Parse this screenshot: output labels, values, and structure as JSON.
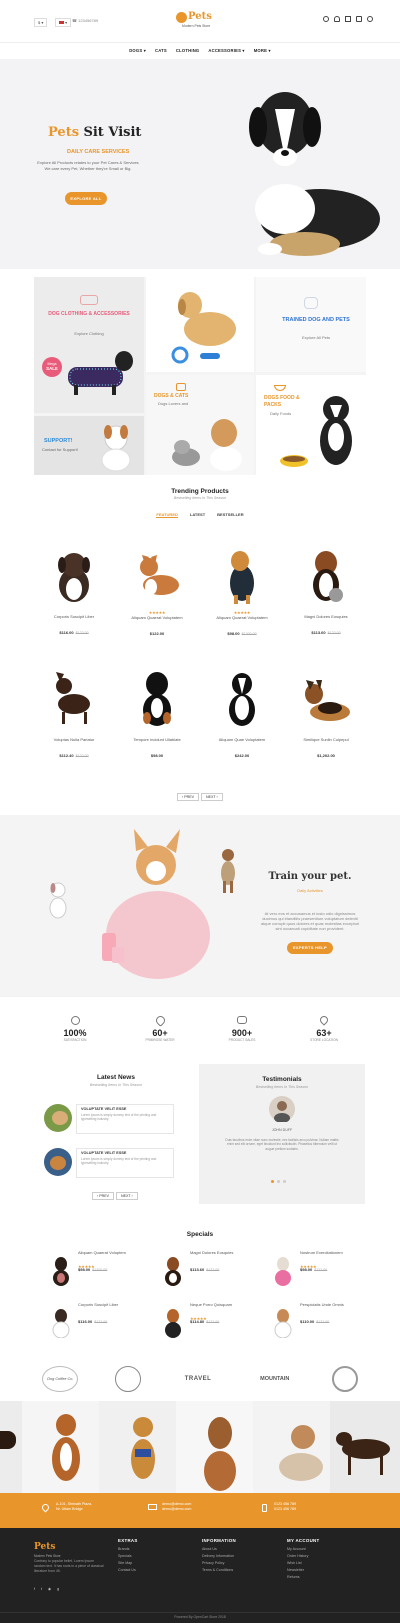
{
  "header": {
    "currency": "$",
    "phone": "123456789",
    "logo_text": "Pets",
    "logo_sub": "Modern Pets Store",
    "nav": [
      "DOGS",
      "CATS",
      "CLOTHING",
      "ACCESSORIES",
      "MORE"
    ]
  },
  "hero": {
    "title_a": "Pets",
    "title_b": "Sit Visit",
    "subtitle": "DAILY CARE SERVICES",
    "desc_1": "Explore All Products relates to your Pet Cares & Services",
    "desc_2": "We care every Pet, Whether they're Small or Big.",
    "cta": "EXPLORE ALL"
  },
  "banners": {
    "clothing_title": "DOG CLOTHING & ACCESSORIES",
    "clothing_sub": "Explore Clothing",
    "sale_a": "Mega",
    "sale_b": "SALE",
    "support_title": "SUPPORT!",
    "support_sub": "Contact for Support!",
    "trained_title": "TRAINED DOG AND PETS",
    "trained_sub": "Explore All Pets",
    "dogscats_title": "DOGS & CATS",
    "dogscats_sub": "Dogs Lovers and",
    "food_title": "DOGS FOOD & PACKS",
    "food_sub": "Daily Foods"
  },
  "trending": {
    "title": "Trending Products",
    "subtitle": "Bestselling Items In This Season",
    "tabs": [
      "FEATURED",
      "LATEST",
      "BESTSELLER"
    ],
    "prev": "PREV",
    "next": "NEXT",
    "products": [
      {
        "name": "Corporis Suscipit Liber",
        "price": "$116.00",
        "old": "$122.00",
        "stars": ""
      },
      {
        "name": "Aliquam Quaerat Voluptatem",
        "price": "$122.00",
        "old": "",
        "stars": "★★★★★"
      },
      {
        "name": "Aliquam Quaerat Voluptatem",
        "price": "$98.00",
        "old": "$1200.00",
        "stars": "★★★★★"
      },
      {
        "name": "Magni Dolores Eosquies",
        "price": "$113.60",
        "old": "$122.00",
        "stars": ""
      },
      {
        "name": "Voluptas Nulla Pariatur",
        "price": "$112.40",
        "old": "$122.00",
        "stars": ""
      },
      {
        "name": "Tempore Incidunt Ullablate",
        "price": "$98.00",
        "old": "",
        "stars": ""
      },
      {
        "name": "Aliquam Quae Voluptatem",
        "price": "$242.00",
        "old": "",
        "stars": ""
      },
      {
        "name": "Similique Sunlin Culpepul",
        "price": "$1,202.00",
        "old": "",
        "stars": ""
      }
    ]
  },
  "train": {
    "title": "Train your pet.",
    "subtitle": "Daily Activities",
    "text": "At vero eos et accusamus et iusto odio dignissimos ducimus qui blanditiis praesentium voluptatum deleniti atque corrupti quos dolores et quas molestias excepturi sint occaecati cupiditate non provident.",
    "cta": "EXPERTS HELP"
  },
  "stats": [
    {
      "value": "100%",
      "label": "SATISFACTION"
    },
    {
      "value": "60+",
      "label": "PRIMROSE WATER"
    },
    {
      "value": "900+",
      "label": "PRODUCT SALES"
    },
    {
      "value": "63+",
      "label": "STORE LOCATION"
    }
  ],
  "news": {
    "title": "Latest News",
    "subtitle": "Bestselling Items In This Season",
    "items": [
      {
        "title": "VOLUPTATE VELIT ESSE",
        "text": "Lorem ipsum is simply dummy text of the printing and typesetting industry."
      },
      {
        "title": "VOLUPTATE VELIT ESSE",
        "text": "Lorem ipsum is simply dummy text of the printing and typesetting industry."
      }
    ],
    "prev": "PREV",
    "next": "NEXT"
  },
  "testimonials": {
    "title": "Testimonials",
    "subtitle": "Bestselling Items In This Season",
    "name": "JOHN DUFF",
    "text": "Duis faucibus enim vitae nunc molestie, nec facilisis arcu pulvinar. Nullam mattis enim sed elit ornare, eget tincidunt leo sollicitudin. Phasellus bibendum velit ut augue pretium sodales."
  },
  "specials": {
    "title": "Specials",
    "items": [
      {
        "name": "Aliquam Quaerat Voluptem",
        "price": "$98.00",
        "old": "$1200.00",
        "stars": "★★★★★"
      },
      {
        "name": "Magni Dolores Eosquies",
        "price": "$113.60",
        "old": "$122.00",
        "stars": ""
      },
      {
        "name": "Nostrum Exercitationem",
        "price": "$98.00",
        "old": "$122.00",
        "stars": "★★★★★"
      },
      {
        "name": "Corporis Suscipit Liber",
        "price": "$116.00",
        "old": "$122.00",
        "stars": ""
      },
      {
        "name": "Neque Porro Quisquam",
        "price": "$114.80",
        "old": "$122.00",
        "stars": "★★★★★"
      },
      {
        "name": "Perspiciatis Unde Omnis",
        "price": "$110.00",
        "old": "$122.00",
        "stars": ""
      }
    ]
  },
  "brands": [
    "Dog Coffee Co.",
    "",
    "TRAVEL",
    "MOUNTAIN",
    ""
  ],
  "contact": {
    "address_1": "A-101, Shrinath Plaza,",
    "address_2": "Nr. Uttam Bridge",
    "email_1": "demo@demo.com",
    "email_2": "demo@demo.com",
    "phone_1": "0123 456 789",
    "phone_2": "0123 456 789"
  },
  "footer": {
    "logo_text": "Pets",
    "logo_sub": "Modern Pets Store",
    "about": "Contrary to popular belief, Lorem Ipsum random text. It has roots in a piece of classical literature from 45.",
    "cols": [
      {
        "title": "EXTRAS",
        "links": [
          "Brands",
          "Specials",
          "Site Map",
          "Contact Us"
        ]
      },
      {
        "title": "INFORMATION",
        "links": [
          "About Us",
          "Delivery Information",
          "Privacy Policy",
          "Terms & Conditions"
        ]
      },
      {
        "title": "MY ACCOUNT",
        "links": [
          "My Account",
          "Order History",
          "Wish List",
          "Newsletter",
          "Returns"
        ]
      }
    ],
    "copyright": "Powered By OpenCart Store 2018"
  },
  "colors": {
    "accent": "#e8962b",
    "footer_bg": "#222222",
    "contact_bg": "#e8962b"
  }
}
